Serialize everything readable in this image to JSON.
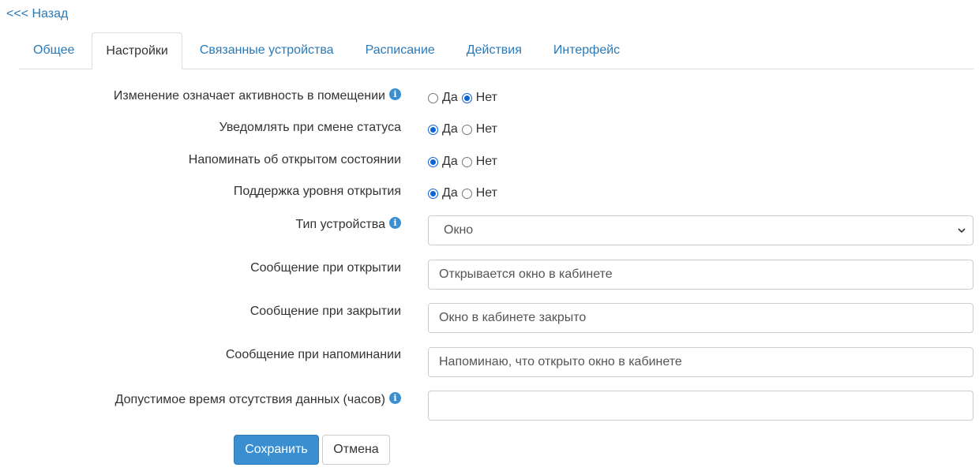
{
  "back_link": "<<< Назад",
  "tabs": [
    {
      "label": "Общее",
      "active": false
    },
    {
      "label": "Настройки",
      "active": true
    },
    {
      "label": "Связанные устройства",
      "active": false
    },
    {
      "label": "Расписание",
      "active": false
    },
    {
      "label": "Действия",
      "active": false
    },
    {
      "label": "Интерфейс",
      "active": false
    }
  ],
  "form": {
    "activity": {
      "label": "Изменение означает активность в помещении",
      "yes": "Да",
      "no": "Нет",
      "value": "no"
    },
    "notify_status": {
      "label": "Уведомлять при смене статуса",
      "yes": "Да",
      "no": "Нет",
      "value": "yes"
    },
    "remind_open": {
      "label": "Напоминать об открытом состоянии",
      "yes": "Да",
      "no": "Нет",
      "value": "yes"
    },
    "open_level": {
      "label": "Поддержка уровня открытия",
      "yes": "Да",
      "no": "Нет",
      "value": "yes"
    },
    "device_type": {
      "label": "Тип устройства",
      "value": "Окно"
    },
    "open_message": {
      "label": "Сообщение при открытии",
      "value": "Открывается окно в кабинете"
    },
    "close_message": {
      "label": "Сообщение при закрытии",
      "value": "Окно в кабинете закрыто"
    },
    "remind_message": {
      "label": "Сообщение при напоминании",
      "value": "Напоминаю, что открыто окно в кабинете"
    },
    "timeout": {
      "label": "Допустимое время отсутствия данных (часов)",
      "value": ""
    }
  },
  "buttons": {
    "save": "Сохранить",
    "cancel": "Отмена"
  },
  "colors": {
    "link": "#2a7ab8",
    "primary": "#3a8fd0",
    "radio_checked": "#0b63d4"
  }
}
